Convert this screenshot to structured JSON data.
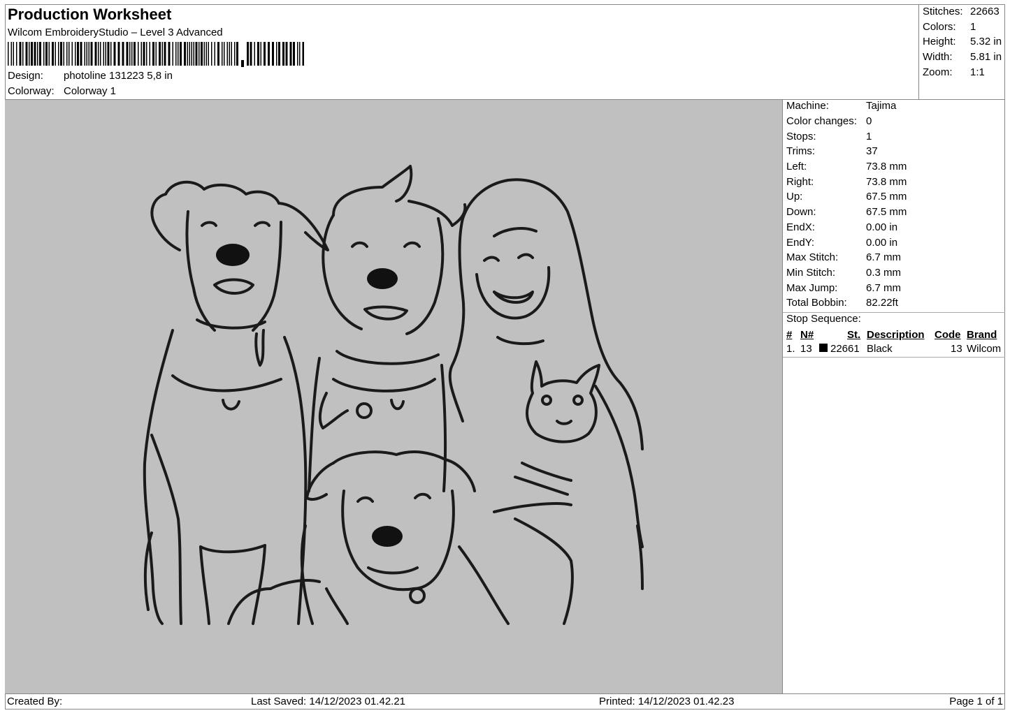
{
  "header": {
    "title": "Production Worksheet",
    "software": "Wilcom EmbroideryStudio – Level 3 Advanced",
    "design_label": "Design:",
    "design_value": "photoline 131223 5,8 in",
    "colorway_label": "Colorway:",
    "colorway_value": "Colorway 1"
  },
  "stats": [
    {
      "label": "Stitches:",
      "value": "22663"
    },
    {
      "label": "Colors:",
      "value": "1"
    },
    {
      "label": "Height:",
      "value": "5.32 in"
    },
    {
      "label": "Width:",
      "value": "5.81 in"
    },
    {
      "label": "Zoom:",
      "value": "1:1"
    }
  ],
  "machine_info": [
    {
      "label": "Machine:",
      "value": "Tajima"
    },
    {
      "label": "Color changes:",
      "value": "0"
    },
    {
      "label": "Stops:",
      "value": "1"
    },
    {
      "label": "Trims:",
      "value": "37"
    },
    {
      "label": "Left:",
      "value": "73.8 mm"
    },
    {
      "label": "Right:",
      "value": "73.8 mm"
    },
    {
      "label": "Up:",
      "value": "67.5 mm"
    },
    {
      "label": "Down:",
      "value": "67.5 mm"
    },
    {
      "label": "EndX:",
      "value": "0.00 in"
    },
    {
      "label": "EndY:",
      "value": "0.00 in"
    },
    {
      "label": "Max Stitch:",
      "value": "6.7 mm"
    },
    {
      "label": "Min Stitch:",
      "value": "0.3 mm"
    },
    {
      "label": "Max Jump:",
      "value": "6.7 mm"
    },
    {
      "label": "Total Bobbin:",
      "value": "82.22ft"
    }
  ],
  "stop_sequence": {
    "title": "Stop Sequence:",
    "columns": [
      "#",
      "N#",
      "St.",
      "Description",
      "Code",
      "Brand"
    ],
    "rows": [
      {
        "num": "1.",
        "needle": "13",
        "color": "#000000",
        "stitches": "22661",
        "description": "Black",
        "code": "13",
        "brand": "Wilcom"
      }
    ]
  },
  "footer": {
    "created_by": "Created By:",
    "last_saved": "Last Saved: 14/12/2023 01.42.21",
    "printed": "Printed: 14/12/2023 01.42.23",
    "page": "Page 1 of 1"
  }
}
